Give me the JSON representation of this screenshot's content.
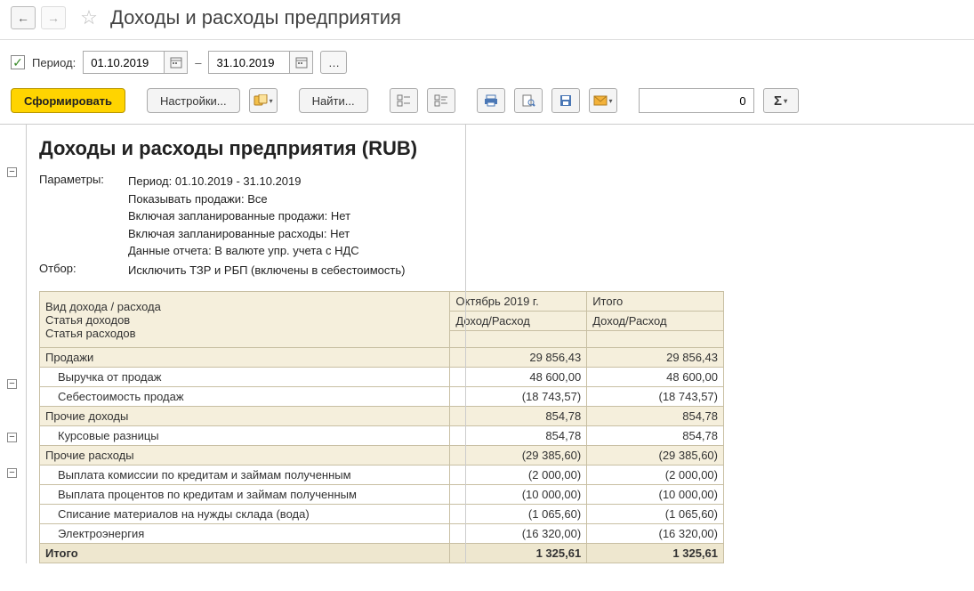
{
  "header": {
    "title": "Доходы и расходы предприятия"
  },
  "period": {
    "label": "Период:",
    "from": "01.10.2019",
    "to": "31.10.2019"
  },
  "toolbar": {
    "generate": "Сформировать",
    "settings": "Настройки...",
    "find": "Найти...",
    "num_value": "0"
  },
  "report": {
    "title": "Доходы и расходы предприятия (RUB)",
    "params_label": "Параметры:",
    "filter_label": "Отбор:",
    "params": [
      "Период: 01.10.2019 - 31.10.2019",
      "Показывать продажи: Все",
      "Включая запланированные продажи: Нет",
      "Включая запланированные расходы: Нет",
      "Данные отчета: В валюте упр. учета с НДС"
    ],
    "filter": "Исключить ТЗР и РБП (включены в себестоимость)",
    "table": {
      "col_kind": "Вид дохода / расхода",
      "col_income": "Статья доходов",
      "col_expense": "Статья расходов",
      "col_period": "Октябрь 2019 г.",
      "col_total": "Итого",
      "sub_col": "Доход/Расход",
      "total_label": "Итого",
      "rows": [
        {
          "group": true,
          "name": "Продажи",
          "oct": "29 856,43",
          "total": "29 856,43"
        },
        {
          "name": "Выручка от продаж",
          "oct": "48 600,00",
          "total": "48 600,00"
        },
        {
          "name": "Себестоимость продаж",
          "oct": "(18 743,57)",
          "total": "(18 743,57)"
        },
        {
          "group": true,
          "name": "Прочие доходы",
          "oct": "854,78",
          "total": "854,78"
        },
        {
          "name": "Курсовые разницы",
          "oct": "854,78",
          "total": "854,78"
        },
        {
          "group": true,
          "name": "Прочие расходы",
          "oct": "(29 385,60)",
          "total": "(29 385,60)"
        },
        {
          "name": "Выплата комиссии по кредитам и займам полученным",
          "oct": "(2 000,00)",
          "total": "(2 000,00)"
        },
        {
          "name": "Выплата процентов по кредитам и займам полученным",
          "oct": "(10 000,00)",
          "total": "(10 000,00)"
        },
        {
          "name": "Списание материалов на нужды склада (вода)",
          "oct": "(1 065,60)",
          "total": "(1 065,60)"
        },
        {
          "name": "Электроэнергия",
          "oct": "(16 320,00)",
          "total": "(16 320,00)"
        }
      ],
      "grand_total": {
        "oct": "1 325,61",
        "total": "1 325,61"
      }
    }
  }
}
